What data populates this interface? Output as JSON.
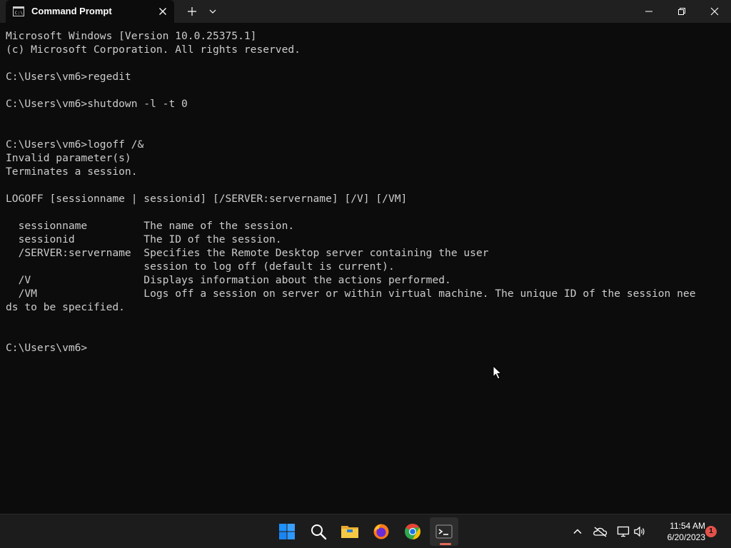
{
  "window": {
    "tab_title": "Command Prompt"
  },
  "console": {
    "lines": [
      "Microsoft Windows [Version 10.0.25375.1]",
      "(c) Microsoft Corporation. All rights reserved.",
      "",
      "C:\\Users\\vm6>regedit",
      "",
      "C:\\Users\\vm6>shutdown -l -t 0",
      "",
      "",
      "C:\\Users\\vm6>logoff /&",
      "Invalid parameter(s)",
      "Terminates a session.",
      "",
      "LOGOFF [sessionname | sessionid] [/SERVER:servername] [/V] [/VM]",
      "",
      "  sessionname         The name of the session.",
      "  sessionid           The ID of the session.",
      "  /SERVER:servername  Specifies the Remote Desktop server containing the user",
      "                      session to log off (default is current).",
      "  /V                  Displays information about the actions performed.",
      "  /VM                 Logs off a session on server or within virtual machine. The unique ID of the session nee",
      "ds to be specified.",
      "",
      "",
      "C:\\Users\\vm6>"
    ]
  },
  "taskbar": {
    "apps": [
      {
        "name": "start",
        "icon": "windows-logo-icon"
      },
      {
        "name": "search",
        "icon": "search-icon"
      },
      {
        "name": "file-explorer",
        "icon": "folder-icon"
      },
      {
        "name": "firefox",
        "icon": "firefox-icon"
      },
      {
        "name": "chrome",
        "icon": "chrome-icon"
      },
      {
        "name": "terminal",
        "icon": "terminal-icon",
        "active": true
      }
    ],
    "tray": [
      "chevron-up-icon",
      "onedrive-offline-icon",
      "network-icon",
      "volume-icon"
    ],
    "time": "11:54 AM",
    "date": "6/20/2023",
    "notification_count": "1"
  },
  "colors": {
    "console_bg": "#0c0c0c",
    "console_fg": "#cccccc",
    "titlebar_bg": "#202020",
    "taskbar_bg": "#1c1c1c",
    "accent": "#e2524a"
  }
}
